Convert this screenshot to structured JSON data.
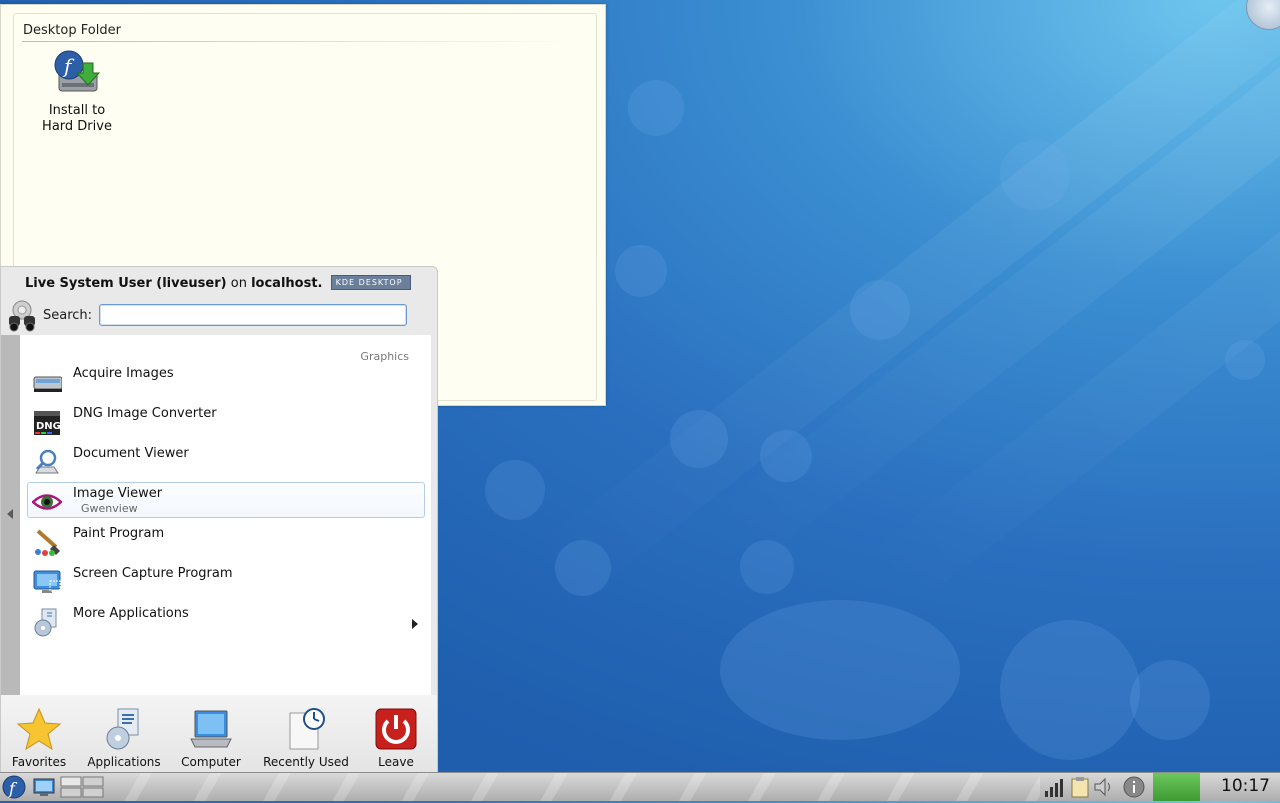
{
  "desktop_folder": {
    "title": "Desktop Folder",
    "icons": [
      {
        "label_line1": "Install to",
        "label_line2": "Hard Drive",
        "icon": "fedora-install-icon"
      }
    ]
  },
  "kickoff": {
    "user_name": "Live System User (liveuser)",
    "user_on": "on",
    "host": "localhost.",
    "badge_text": "KDE DESKTOP",
    "search_label": "Search:",
    "search_value": "",
    "category": "Graphics",
    "items": [
      {
        "name": "Acquire Images",
        "sub": "",
        "icon": "scanner-icon"
      },
      {
        "name": "DNG Image Converter",
        "sub": "",
        "icon": "dng-icon"
      },
      {
        "name": "Document Viewer",
        "sub": "",
        "icon": "document-viewer-icon"
      },
      {
        "name": "Image Viewer",
        "sub": "Gwenview",
        "icon": "eye-icon"
      },
      {
        "name": "Paint Program",
        "sub": "",
        "icon": "paintbrush-icon"
      },
      {
        "name": "Screen Capture Program",
        "sub": "",
        "icon": "screen-capture-icon"
      },
      {
        "name": "More Applications",
        "sub": "",
        "icon": "applications-icon"
      }
    ],
    "tabs": [
      {
        "label": "Favorites",
        "icon": "star-icon"
      },
      {
        "label": "Applications",
        "icon": "applications-icon"
      },
      {
        "label": "Computer",
        "icon": "laptop-icon"
      },
      {
        "label": "Recently Used",
        "icon": "clock-icon"
      },
      {
        "label": "Leave",
        "icon": "power-icon"
      }
    ]
  },
  "panel": {
    "clock": "10:17"
  },
  "colors": {
    "desktop_blue": "#2a6fbf",
    "selection_border": "#b5cde8",
    "leave_red": "#c8201c"
  }
}
